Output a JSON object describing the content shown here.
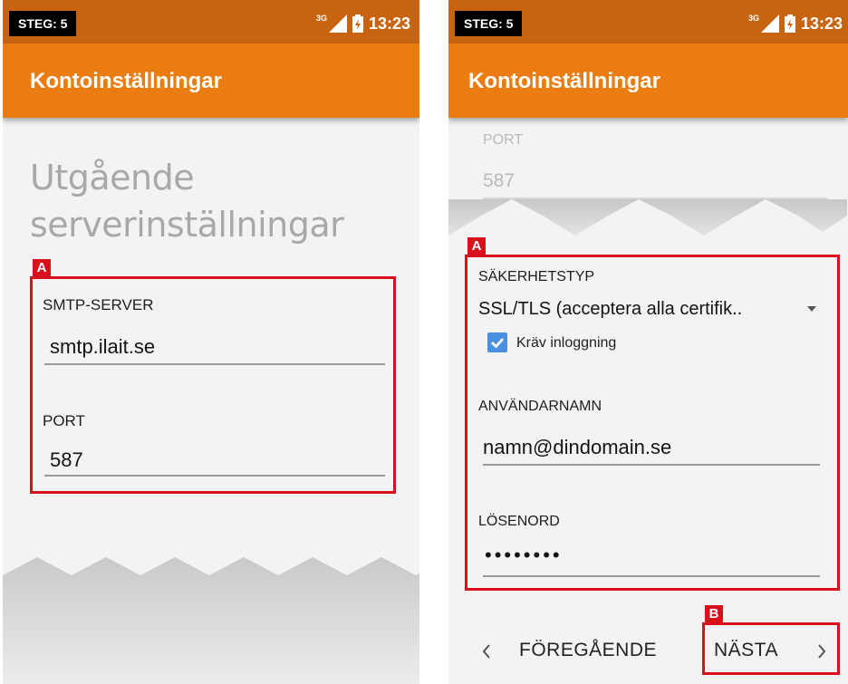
{
  "left_screen": {
    "status": {
      "step": "STEG: 5",
      "network": "3G",
      "time": "13:23"
    },
    "toolbar_title": "Kontoinställningar",
    "headline_line1": "Utgående",
    "headline_line2": "serverinställningar",
    "box_tag": "A",
    "smtp_label": "SMTP-SERVER",
    "smtp_value": "smtp.ilait.se",
    "port_label": "PORT",
    "port_value": "587"
  },
  "right_screen": {
    "status": {
      "step": "STEG: 5",
      "network": "3G",
      "time": "13:23"
    },
    "toolbar_title": "Kontoinställningar",
    "port_label": "PORT",
    "port_value": "587",
    "box_a_tag": "A",
    "security_label": "SÄKERHETSTYP",
    "security_value": "SSL/TLS (acceptera alla certifik..",
    "require_login_label": "Kräv inloggning",
    "require_login_checked": true,
    "username_label": "ANVÄNDARNAMN",
    "username_value": "namn@dindomain.se",
    "password_label": "LÖSENORD",
    "password_value": "••••••••",
    "box_b_tag": "B",
    "prev_button": "FÖREGÅENDE",
    "next_button": "NÄSTA"
  },
  "colors": {
    "toolbar": "#ea7c12",
    "statusbar": "#c8640f",
    "highlight": "#d8101c",
    "checkbox": "#4a90e2"
  }
}
